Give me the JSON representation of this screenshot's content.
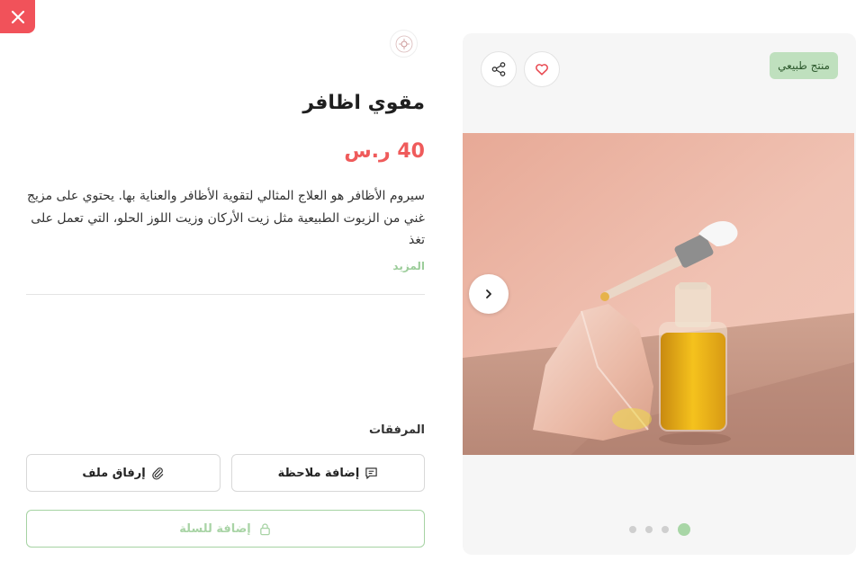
{
  "product": {
    "title": "مقوي اظافر",
    "price": "40 ر.س",
    "description": "سيروم الأظافر هو العلاج المثالي لتقوية الأظافر والعناية بها. يحتوي على مزيج غني من الزيوت الطبيعية مثل زيت الأركان وزيت اللوز الحلو، التي تعمل على تغذ",
    "more_label": "المزيد",
    "badge": "منتج طبيعي"
  },
  "attachments": {
    "label": "المرفقات",
    "add_note_label": "إضافة ملاحظة",
    "attach_file_label": "إرفاق ملف"
  },
  "cart": {
    "add_label": "إضافة للسلة"
  },
  "gallery": {
    "slide_count": 4,
    "active_index": 0
  },
  "colors": {
    "close": "#f1525a",
    "price": "#ef5b5b",
    "accent_green": "#a8d6a6",
    "badge_bg": "#bfe0be"
  },
  "icons": [
    "close-icon",
    "brand-logo",
    "share-icon",
    "heart-icon",
    "chevron-right-icon",
    "note-icon",
    "paperclip-icon",
    "lock-icon"
  ]
}
